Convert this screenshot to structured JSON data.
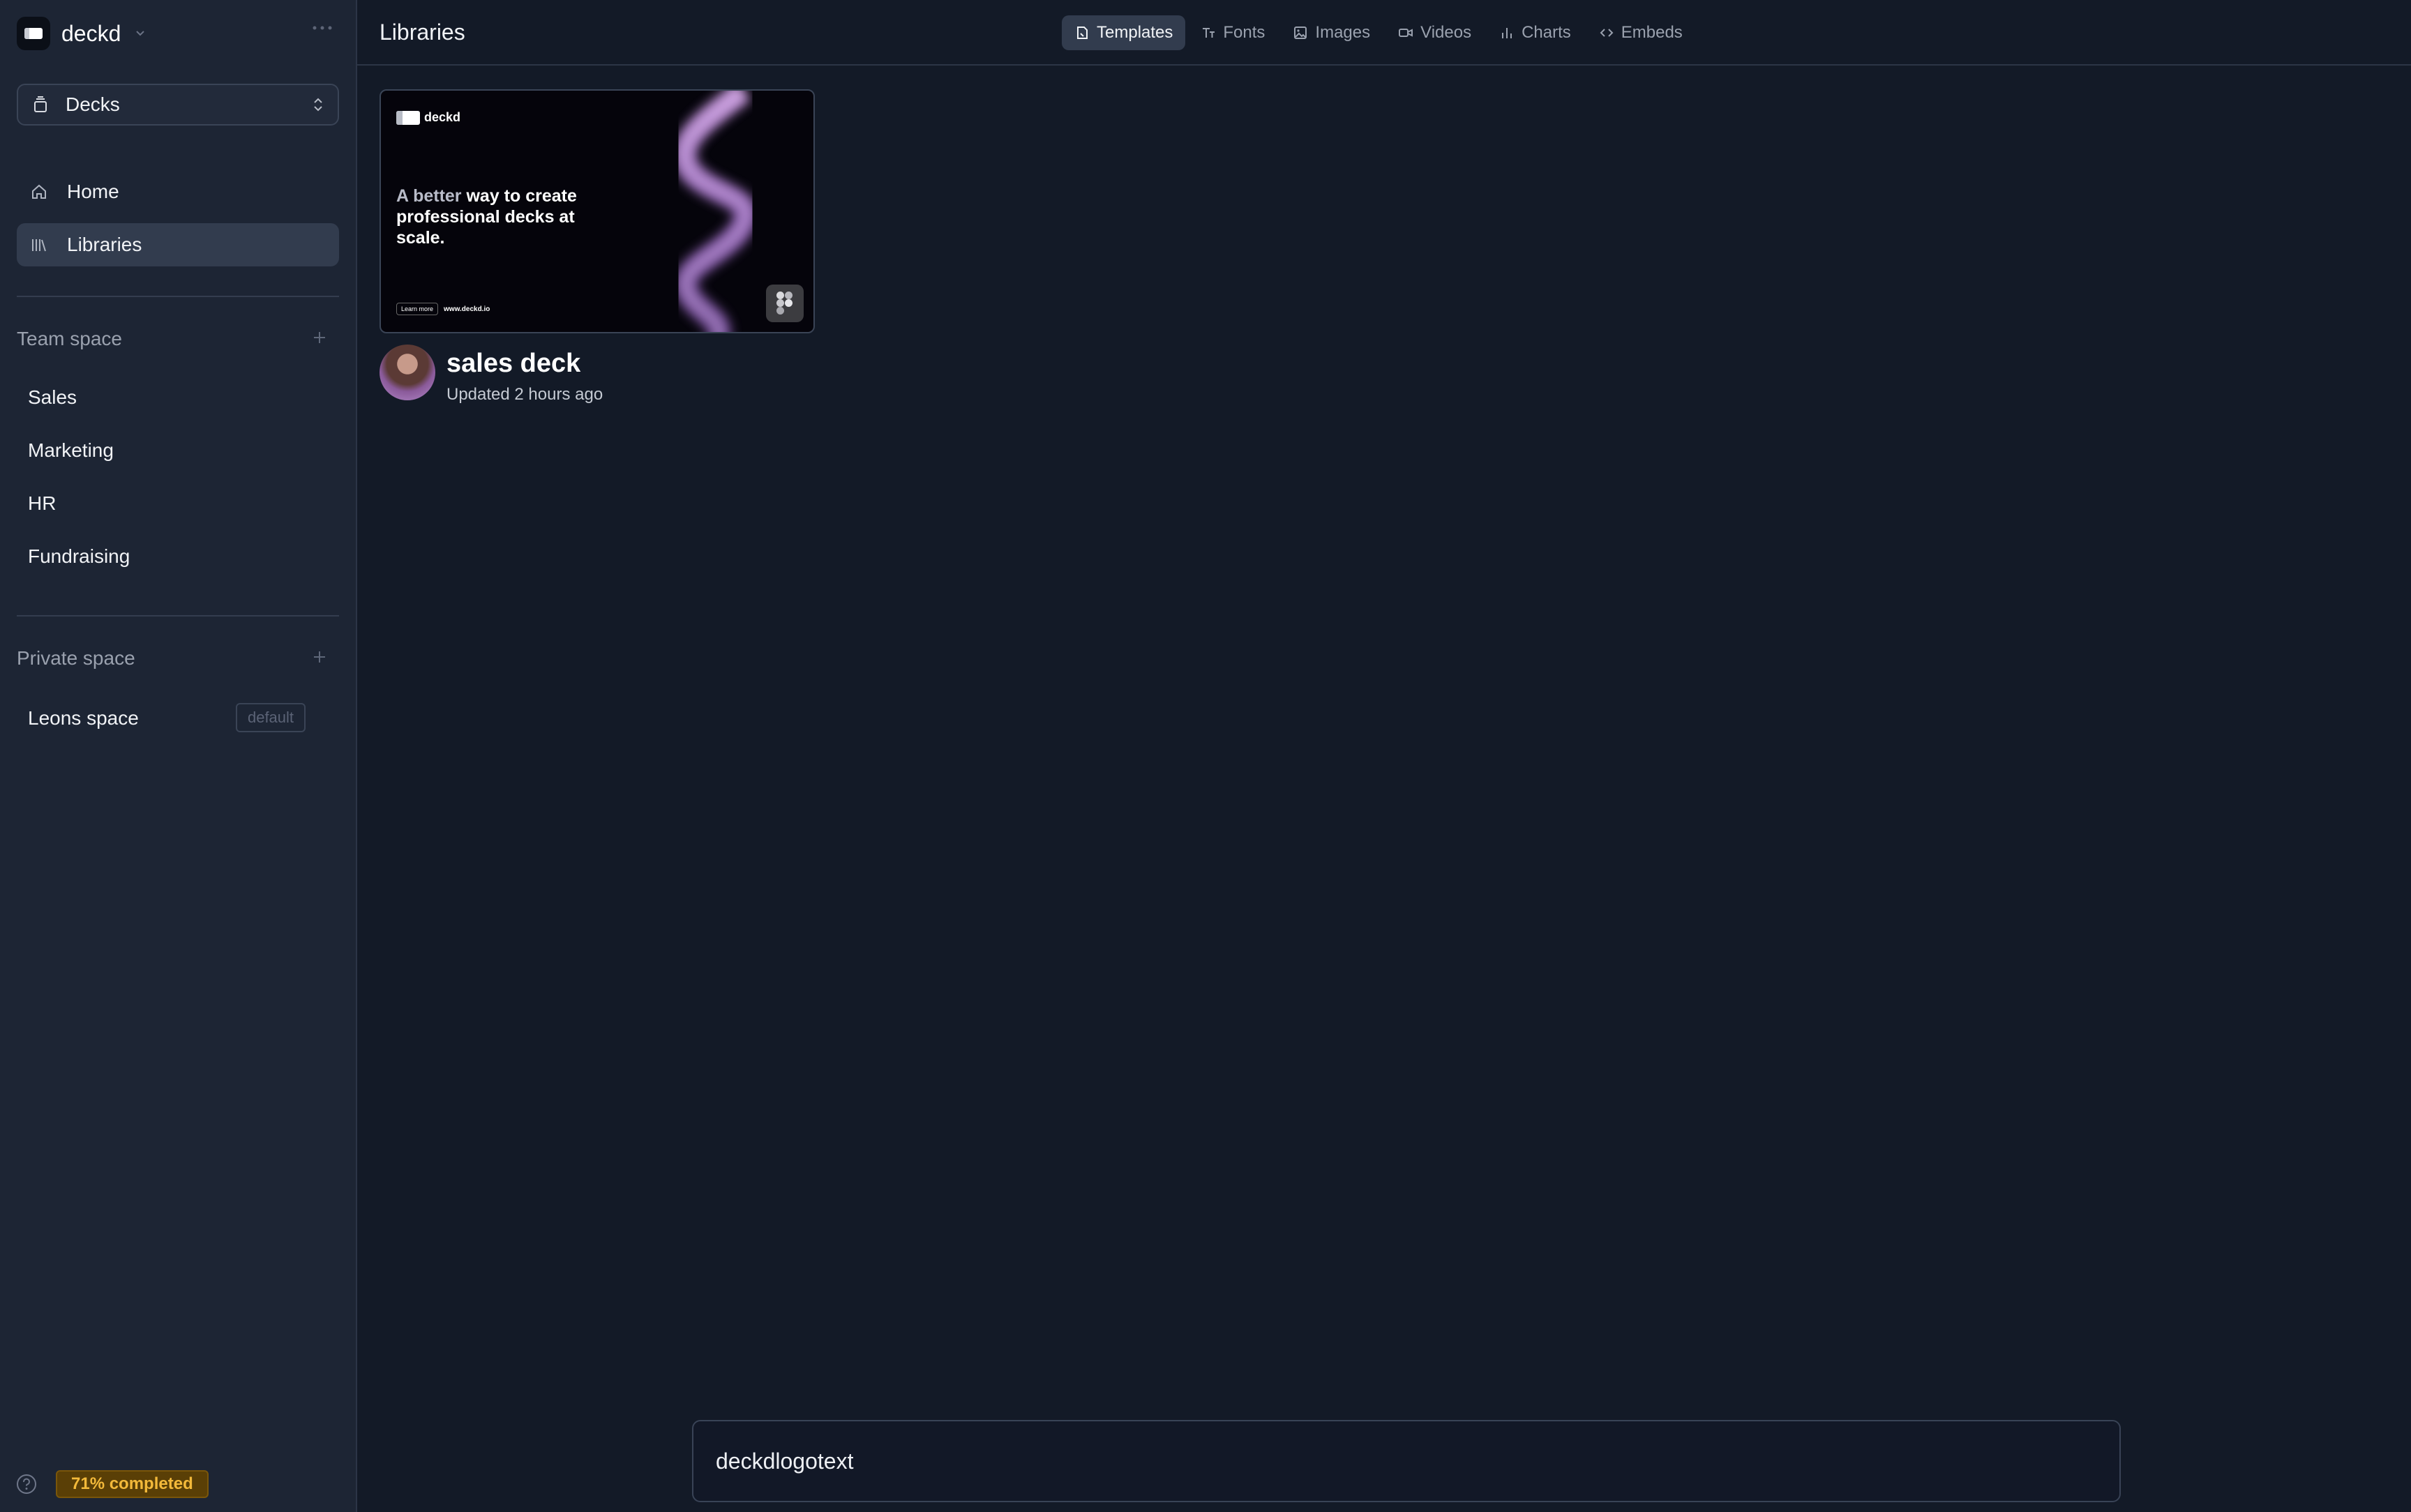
{
  "workspace": {
    "name": "deckd"
  },
  "sidebar": {
    "selector_label": "Decks",
    "nav": [
      {
        "label": "Home",
        "icon": "home-icon"
      },
      {
        "label": "Libraries",
        "icon": "library-icon",
        "active": true
      }
    ],
    "team_space": {
      "title": "Team space",
      "items": [
        "Sales",
        "Marketing",
        "HR",
        "Fundraising"
      ]
    },
    "private_space": {
      "title": "Private space",
      "items": [
        {
          "label": "Leons space",
          "tag": "default"
        }
      ]
    },
    "progress_label": "71% completed"
  },
  "header": {
    "title": "Libraries",
    "tabs": [
      {
        "label": "Templates",
        "icon": "template-icon",
        "active": true
      },
      {
        "label": "Fonts",
        "icon": "font-icon"
      },
      {
        "label": "Images",
        "icon": "image-icon"
      },
      {
        "label": "Videos",
        "icon": "video-icon"
      },
      {
        "label": "Charts",
        "icon": "chart-icon"
      },
      {
        "label": "Embeds",
        "icon": "code-icon"
      }
    ]
  },
  "cards": [
    {
      "title": "sales deck",
      "updated": "Updated 2 hours ago",
      "thumbnail": {
        "brand": "deckd",
        "headline_dim": "A better",
        "headline_rest": "way to create professional decks at scale.",
        "button": "Learn more",
        "url": "www.deckd.io"
      }
    }
  ],
  "bottom_input": {
    "value": "deckdlogotext"
  },
  "colors": {
    "accent_badge": "#f3b93a",
    "active_bg": "#323c4e",
    "background": "#131a27"
  }
}
